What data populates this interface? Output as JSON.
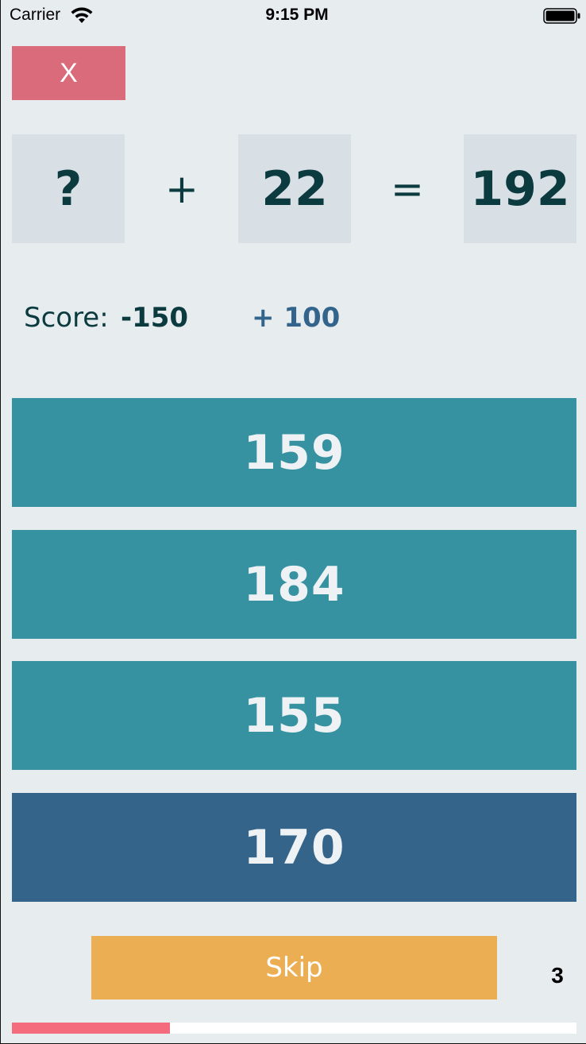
{
  "status_bar": {
    "carrier": "Carrier",
    "time": "9:15 PM",
    "wifi_icon": "wifi-icon",
    "battery_icon": "battery-icon"
  },
  "close_button": {
    "label": "X",
    "color": "#d96b7a"
  },
  "equation": {
    "operand1": "?",
    "operator": "+",
    "operand2": "22",
    "equals": "=",
    "result": "192"
  },
  "score": {
    "label": "Score:",
    "value": "-150",
    "delta": "+ 100",
    "delta_color": "#33648c"
  },
  "answers": [
    {
      "label": "159",
      "color": "#3692a0"
    },
    {
      "label": "184",
      "color": "#3692a0"
    },
    {
      "label": "155",
      "color": "#3692a0"
    },
    {
      "label": "170",
      "color": "#346489"
    }
  ],
  "skip": {
    "label": "Skip",
    "color": "#ecae53"
  },
  "counter": "3",
  "progress": {
    "fraction": 0.28,
    "color": "#f56b7e"
  }
}
